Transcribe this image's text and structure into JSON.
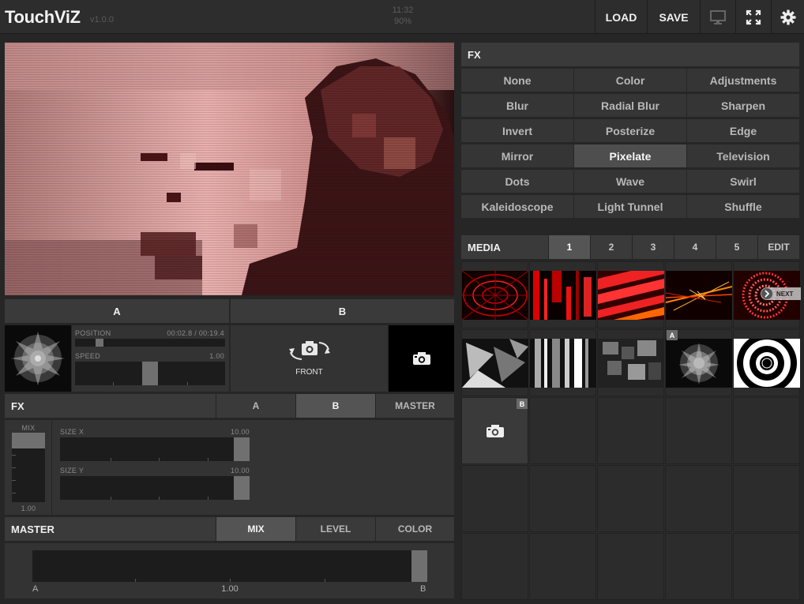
{
  "header": {
    "app_title": "TouchViZ",
    "version": "v1.0.0",
    "clock_time": "11:32",
    "clock_battery": "90%",
    "load_label": "LOAD",
    "save_label": "SAVE"
  },
  "deck": {
    "tab_a": "A",
    "tab_b": "B",
    "position_label": "POSITION",
    "position_value": "00:02.8 / 00:19.4",
    "position_progress": 0.144,
    "speed_label": "SPEED",
    "speed_value": "1.00",
    "camera_label": "FRONT"
  },
  "fx_controls": {
    "title": "FX",
    "targets": [
      "A",
      "B",
      "MASTER"
    ],
    "active_target": "B",
    "mix_label": "MIX",
    "mix_value": "1.00",
    "size_x_label": "SIZE X",
    "size_x_value": "10.00",
    "size_y_label": "SIZE Y",
    "size_y_value": "10.00"
  },
  "master": {
    "title": "MASTER",
    "modes": [
      "MIX",
      "LEVEL",
      "COLOR"
    ],
    "active_mode": "MIX",
    "left_label": "A",
    "center_value": "1.00",
    "right_label": "B"
  },
  "fx_panel": {
    "title": "FX",
    "effects": [
      "None",
      "Color",
      "Adjustments",
      "Blur",
      "Radial Blur",
      "Sharpen",
      "Invert",
      "Posterize",
      "Edge",
      "Mirror",
      "Pixelate",
      "Television",
      "Dots",
      "Wave",
      "Swirl",
      "Kaleidoscope",
      "Light Tunnel",
      "Shuffle"
    ],
    "active_effect": "Pixelate"
  },
  "media": {
    "title": "MEDIA",
    "banks": [
      "1",
      "2",
      "3",
      "4",
      "5"
    ],
    "active_bank": "1",
    "edit_label": "EDIT",
    "next_label": "NEXT",
    "badge_a": "A",
    "badge_b": "B"
  }
}
